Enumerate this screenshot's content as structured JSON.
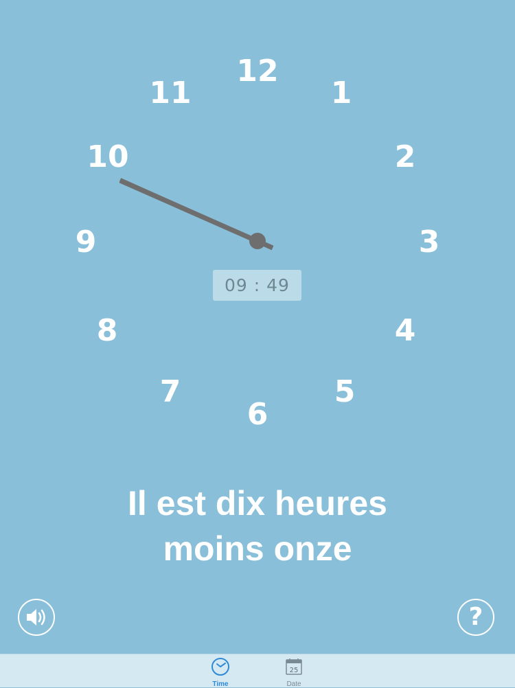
{
  "clock": {
    "numbers": [
      "12",
      "1",
      "2",
      "3",
      "4",
      "5",
      "6",
      "7",
      "8",
      "9",
      "10",
      "11"
    ],
    "hand_color": "#6e6e6e",
    "time": {
      "hour": 9,
      "minute": 49
    }
  },
  "digital_time": "09 : 49",
  "phrase": {
    "line1": "Il est dix heures",
    "line2": "moins onze"
  },
  "buttons": {
    "speaker_icon": "speaker-icon",
    "help_label": "?"
  },
  "tabs": [
    {
      "label": "Time",
      "icon": "clock-icon",
      "active": true
    },
    {
      "label": "Date",
      "icon": "calendar-icon",
      "active": false,
      "icon_text": "25"
    }
  ],
  "colors": {
    "background": "#89bfd9",
    "tabbar": "#d5e9f3",
    "active_tab": "#2f8ad6"
  }
}
